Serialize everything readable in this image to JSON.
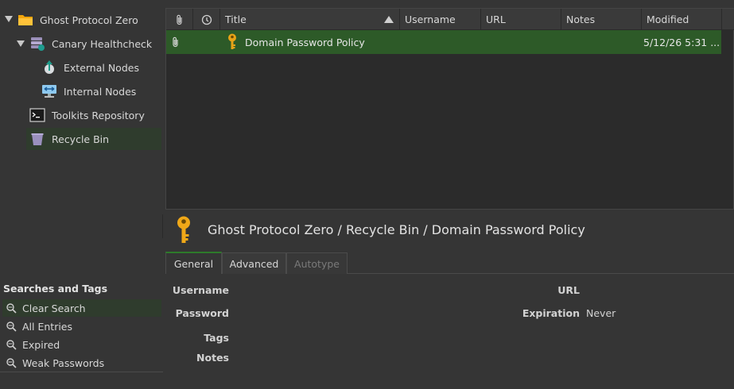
{
  "groups": {
    "root": {
      "label": "Ghost Protocol Zero"
    },
    "items": [
      {
        "label": "Canary Healthcheck"
      },
      {
        "label": "External Nodes"
      },
      {
        "label": "Internal Nodes"
      },
      {
        "label": "Toolkits Repository"
      },
      {
        "label": "Recycle Bin"
      }
    ]
  },
  "searches": {
    "title": "Searches and Tags",
    "items": [
      {
        "label": "Clear Search"
      },
      {
        "label": "All Entries"
      },
      {
        "label": "Expired"
      },
      {
        "label": "Weak Passwords"
      }
    ]
  },
  "table": {
    "columns": [
      "Title",
      "Username",
      "URL",
      "Notes",
      "Modified"
    ],
    "sort_column": "Title",
    "sort_direction": "ascending",
    "rows": [
      {
        "title": "Domain Password Policy",
        "username": "",
        "url": "",
        "notes": "",
        "modified": "5/12/26 5:31 ..."
      }
    ]
  },
  "preview": {
    "path": "Ghost Protocol Zero / Recycle Bin / Domain Password Policy",
    "tabs": [
      {
        "label": "General"
      },
      {
        "label": "Advanced"
      },
      {
        "label": "Autotype"
      }
    ],
    "fields": {
      "username_label": "Username",
      "password_label": "Password",
      "tags_label": "Tags",
      "notes_label": "Notes",
      "url_label": "URL",
      "expiration_label": "Expiration",
      "expiration_value": "Never"
    }
  },
  "colors": {
    "selected_row": "#2d5a28",
    "selected_group": "#2f3c2d",
    "background": "#353535",
    "table_bg": "#2b2b2b"
  }
}
